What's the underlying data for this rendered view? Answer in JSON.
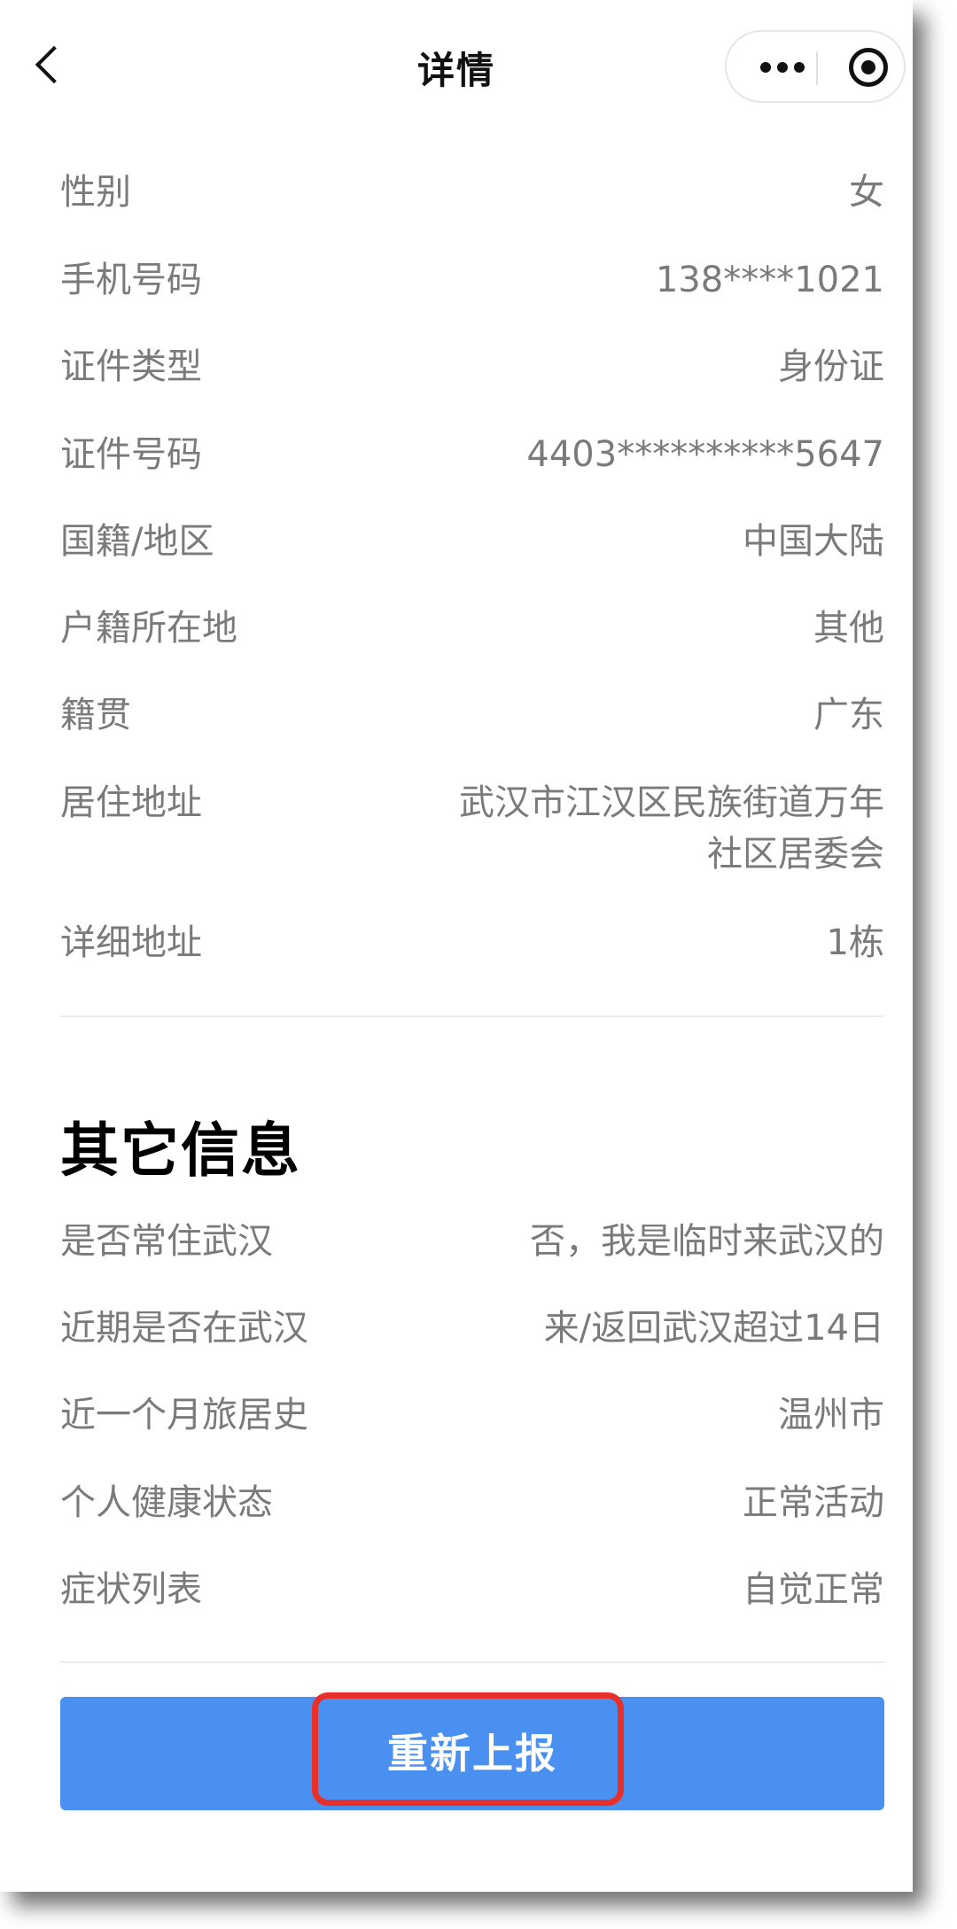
{
  "navbar": {
    "title": "详情"
  },
  "personal_rows": [
    {
      "label": "性别",
      "value": "女"
    },
    {
      "label": "手机号码",
      "value": "138****1021"
    },
    {
      "label": "证件类型",
      "value": "身份证"
    },
    {
      "label": "证件号码",
      "value": "4403**********5647"
    },
    {
      "label": "国籍/地区",
      "value": "中国大陆"
    },
    {
      "label": "户籍所在地",
      "value": "其他"
    },
    {
      "label": "籍贯",
      "value": "广东"
    },
    {
      "label": "居住地址",
      "value_line1": "武汉市江汉区民族街道万年",
      "value_line2": "社区居委会"
    },
    {
      "label": "详细地址",
      "value": "1栋"
    }
  ],
  "other_section": {
    "title": "其它信息",
    "rows": [
      {
        "label": "是否常住武汉",
        "value": "否，我是临时来武汉的"
      },
      {
        "label": "近期是否在武汉",
        "value": "来/返回武汉超过14日"
      },
      {
        "label": "近一个月旅居史",
        "value": "温州市"
      },
      {
        "label": "个人健康状态",
        "value": "正常活动"
      },
      {
        "label": "症状列表",
        "value": "自觉正常"
      }
    ]
  },
  "actions": {
    "resubmit_label": "重新上报"
  },
  "colors": {
    "primary_button": "#4a90f0",
    "highlight_border": "#e8302a",
    "label_text": "#7a7a7a"
  }
}
